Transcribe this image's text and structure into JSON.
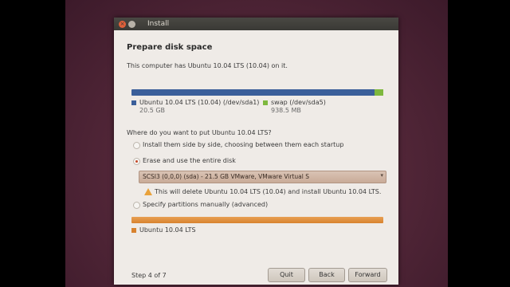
{
  "window": {
    "title": "Install"
  },
  "page": {
    "heading": "Prepare disk space",
    "computer_info": "This computer has Ubuntu 10.04 LTS (10.04) on it."
  },
  "current_partitions": [
    {
      "name": "Ubuntu 10.04 LTS (10.04) (/dev/sda1)",
      "size": "20.5 GB",
      "color": "#3b5f9a"
    },
    {
      "name": "swap (/dev/sda5)",
      "size": "938.5 MB",
      "color": "#7eb83e"
    }
  ],
  "question": "Where do you want to put Ubuntu 10.04 LTS?",
  "options": [
    {
      "label": "Install them side by side, choosing between them each startup",
      "selected": false
    },
    {
      "label": "Erase and use the entire disk",
      "selected": true
    },
    {
      "label": "Specify partitions manually (advanced)",
      "selected": false
    }
  ],
  "disk_select": {
    "value": "SCSI3 (0,0,0) (sda) - 21.5 GB VMware, VMware Virtual S"
  },
  "warning": "This will delete Ubuntu 10.04 LTS (10.04) and install Ubuntu 10.04 LTS.",
  "result_partition": {
    "name": "Ubuntu 10.04 LTS",
    "color": "#d8822e"
  },
  "footer": {
    "step": "Step 4 of 7",
    "quit": "Quit",
    "back": "Back",
    "forward": "Forward"
  },
  "colors": {
    "accent": "#c44a2a",
    "titlebar": "#3a3935"
  }
}
